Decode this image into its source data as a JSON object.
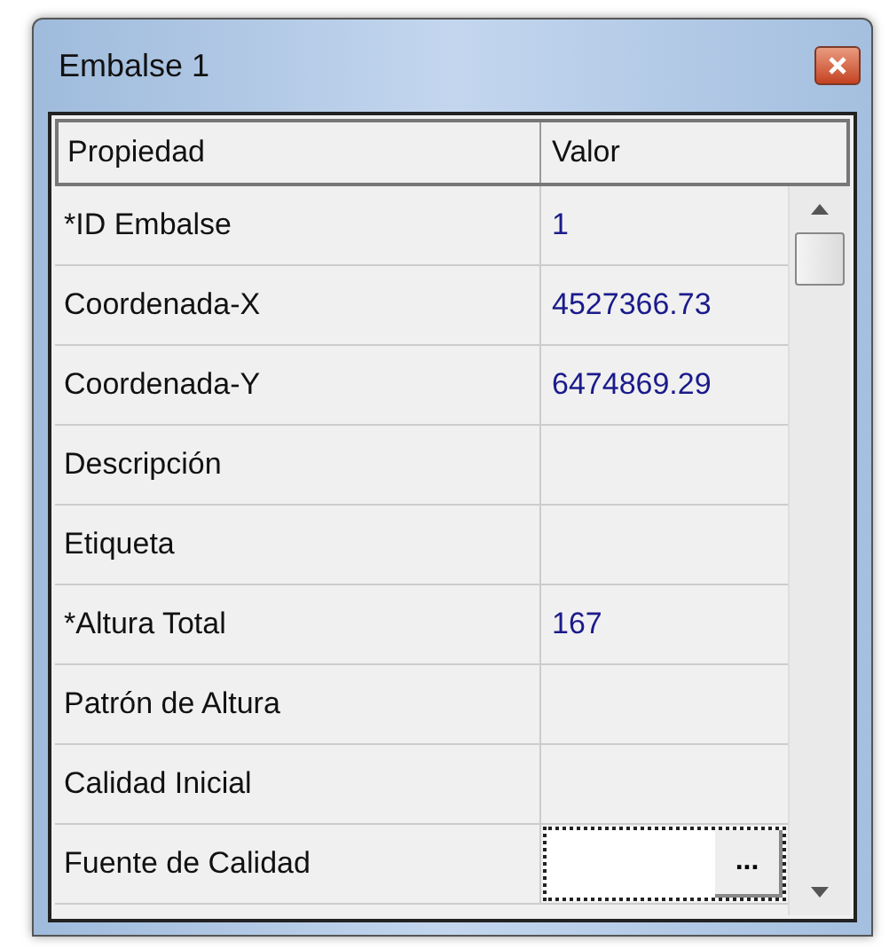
{
  "window": {
    "title": "Embalse 1"
  },
  "table": {
    "columns": [
      "Propiedad",
      "Valor"
    ],
    "rows": [
      {
        "property": "*ID Embalse",
        "value": "1",
        "editing": false
      },
      {
        "property": "Coordenada-X",
        "value": "4527366.73",
        "editing": false
      },
      {
        "property": "Coordenada-Y",
        "value": "6474869.29",
        "editing": false
      },
      {
        "property": "Descripción",
        "editing": false
      },
      {
        "property": "Etiqueta",
        "editing": false
      },
      {
        "property": "*Altura Total",
        "value": "167",
        "editing": false
      },
      {
        "property": "Patrón de Altura",
        "editing": false
      },
      {
        "property": "Calidad Inicial",
        "editing": false
      },
      {
        "property": "Fuente de Calidad",
        "editing": true,
        "button_label": "..."
      }
    ]
  }
}
